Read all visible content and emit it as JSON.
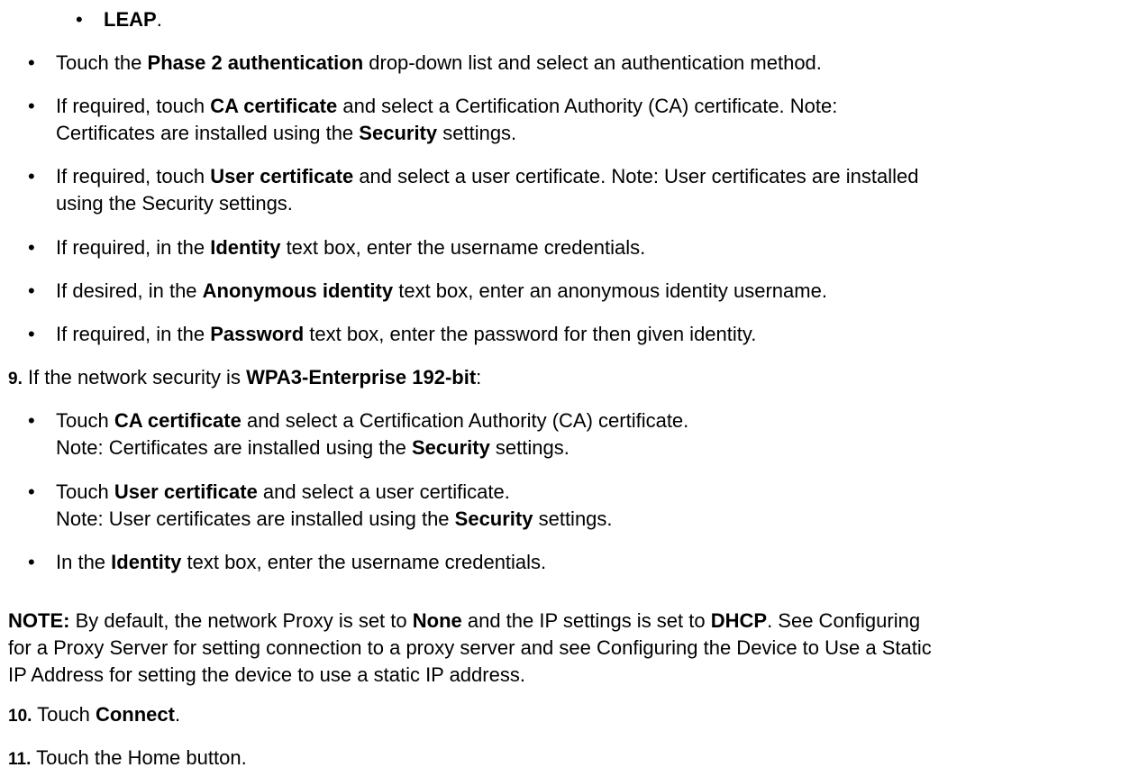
{
  "top_bullet": {
    "bold": "LEAP",
    "tail": "."
  },
  "bullets_a": [
    {
      "pre": "Touch the ",
      "b1": "Phase 2 authentication",
      "post": " drop-down list and select an authentication method."
    },
    {
      "line1_pre": "If required, touch ",
      "line1_b": "CA certificate",
      "line1_post": " and select a Certification Authority (CA) certificate. Note:",
      "line2_pre": "Certificates are installed using the ",
      "line2_b": "Security",
      "line2_post": " settings."
    },
    {
      "line1_pre": "If required, touch ",
      "line1_b": "User certificate",
      "line1_post": " and select a user certificate. Note: User certificates are installed",
      "line2": "using the Security settings."
    },
    {
      "pre": "If required, in the ",
      "b1": "Identity",
      "post": " text box, enter the username credentials."
    },
    {
      "pre": "If desired, in the ",
      "b1": "Anonymous identity",
      "post": " text box, enter an anonymous identity username."
    },
    {
      "pre": "If required, in the ",
      "b1": "Password",
      "post": " text box, enter the password for then given identity."
    }
  ],
  "step9": {
    "num": "9.",
    "pre": " If the network security is ",
    "bold": "WPA3-Enterprise 192-bit",
    "post": ":"
  },
  "bullets_b": [
    {
      "line1_pre": "Touch ",
      "line1_b": "CA certificate",
      "line1_post": " and select a Certification Authority (CA) certificate.",
      "line2_pre": "Note: Certificates are installed using the ",
      "line2_b": "Security",
      "line2_post": " settings."
    },
    {
      "line1_pre": "Touch ",
      "line1_b": "User certificate",
      "line1_post": " and select a user certificate.",
      "line2_pre": "Note: User certificates are installed using the ",
      "line2_b": "Security",
      "line2_post": " settings."
    },
    {
      "pre": "In the ",
      "b1": "Identity",
      "post": " text box, enter the username credentials."
    }
  ],
  "note": {
    "label": "NOTE:",
    "t1": " By default, the network Proxy is set to ",
    "b1": "None",
    "t2": " and the IP settings is set to ",
    "b2": "DHCP",
    "t3": ". See Configuring",
    "line2": "for a Proxy Server for setting connection to a proxy server and see Configuring the Device to Use a Static",
    "line3": "IP Address for setting the device to use a static IP address."
  },
  "step10": {
    "num": "10.",
    "pre": " Touch ",
    "bold": "Connect",
    "post": "."
  },
  "step11": {
    "num": "11.",
    "text": " Touch the Home button."
  }
}
